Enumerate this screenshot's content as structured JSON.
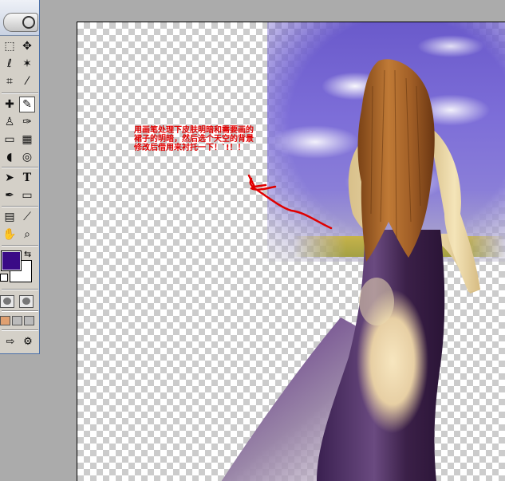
{
  "toolbox": {
    "tools": [
      {
        "name": "marquee-tool",
        "glyph": "⬚"
      },
      {
        "name": "move-tool",
        "glyph": "✥"
      },
      {
        "name": "lasso-tool",
        "glyph": "ℓ"
      },
      {
        "name": "magic-wand-tool",
        "glyph": "✶"
      },
      {
        "name": "crop-tool",
        "glyph": "⌗"
      },
      {
        "name": "slice-tool",
        "glyph": "⁄"
      },
      {
        "name": "healing-brush-tool",
        "glyph": "✚"
      },
      {
        "name": "brush-tool",
        "glyph": "✎"
      },
      {
        "name": "clone-stamp-tool",
        "glyph": "♙"
      },
      {
        "name": "history-brush-tool",
        "glyph": "✑"
      },
      {
        "name": "eraser-tool",
        "glyph": "▭"
      },
      {
        "name": "gradient-tool",
        "glyph": "▦"
      },
      {
        "name": "blur-tool",
        "glyph": "◖"
      },
      {
        "name": "dodge-tool",
        "glyph": "◎"
      },
      {
        "name": "path-selection-tool",
        "glyph": "➤"
      },
      {
        "name": "type-tool",
        "glyph": "T"
      },
      {
        "name": "pen-tool",
        "glyph": "✒"
      },
      {
        "name": "shape-tool",
        "glyph": "▭"
      },
      {
        "name": "notes-tool",
        "glyph": "▤"
      },
      {
        "name": "eyedropper-tool",
        "glyph": "⟋"
      },
      {
        "name": "hand-tool",
        "glyph": "✋"
      },
      {
        "name": "zoom-tool",
        "glyph": "⌕"
      }
    ],
    "active_tool": "brush-tool",
    "foreground_color": "#3a0a86",
    "background_color": "#ffffff"
  },
  "canvas": {
    "annotation_text": "用画笔处理下皮肤明暗和需要画的裙子的明暗，然后选个天空的背景修改后借用来衬托一下！`!！！",
    "annotation_color": "#e00000",
    "dress_color": "#4a2a6a",
    "hair_color": "#a8642a",
    "skin_color": "#f2dfb0"
  }
}
